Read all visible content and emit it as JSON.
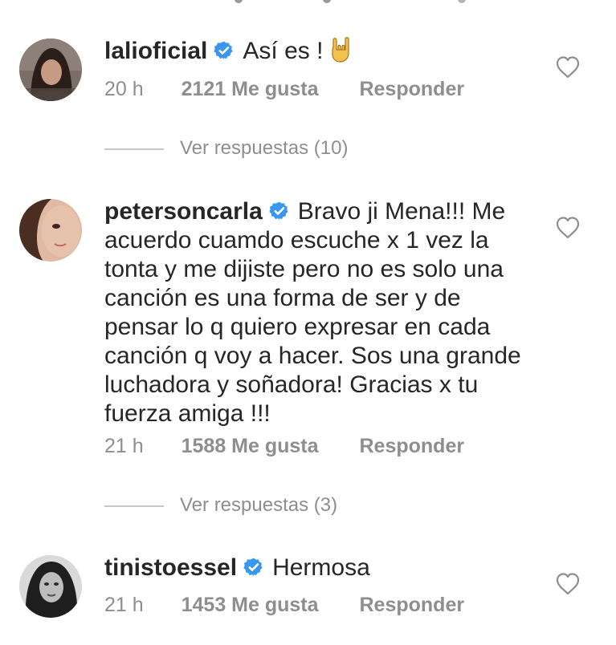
{
  "comments": [
    {
      "username": "lalioficial",
      "text": "Así es !",
      "emoji": "sign-of-the-horns",
      "time": "20 h",
      "likes": "2121 Me gusta",
      "reply_label": "Responder",
      "view_replies": "Ver respuestas (10)"
    },
    {
      "username": "petersoncarla",
      "text": "Bravo ji Mena!!! Me acuerdo cuamdo escuche x 1 vez la tonta y me dijiste pero no es solo una canción es una forma de ser y de pensar lo q quiero expresar en cada canción q voy a hacer. Sos una grande luchadora y soñadora! Gracias x tu fuerza amiga !!!",
      "time": "21 h",
      "likes": "1588 Me gusta",
      "reply_label": "Responder",
      "view_replies": "Ver respuestas (3)"
    },
    {
      "username": "tinistoessel",
      "text": "Hermosa",
      "time": "21 h",
      "likes": "1453 Me gusta",
      "reply_label": "Responder"
    }
  ],
  "colors": {
    "text": "#262626",
    "secondary": "#8e8e8e",
    "verified_blue": "#3897f0",
    "divider": "#c7c7c7"
  },
  "icons": {
    "verified": "verified-badge-icon",
    "like": "heart-outline-icon",
    "emoji": "sign-of-the-horns-emoji"
  }
}
